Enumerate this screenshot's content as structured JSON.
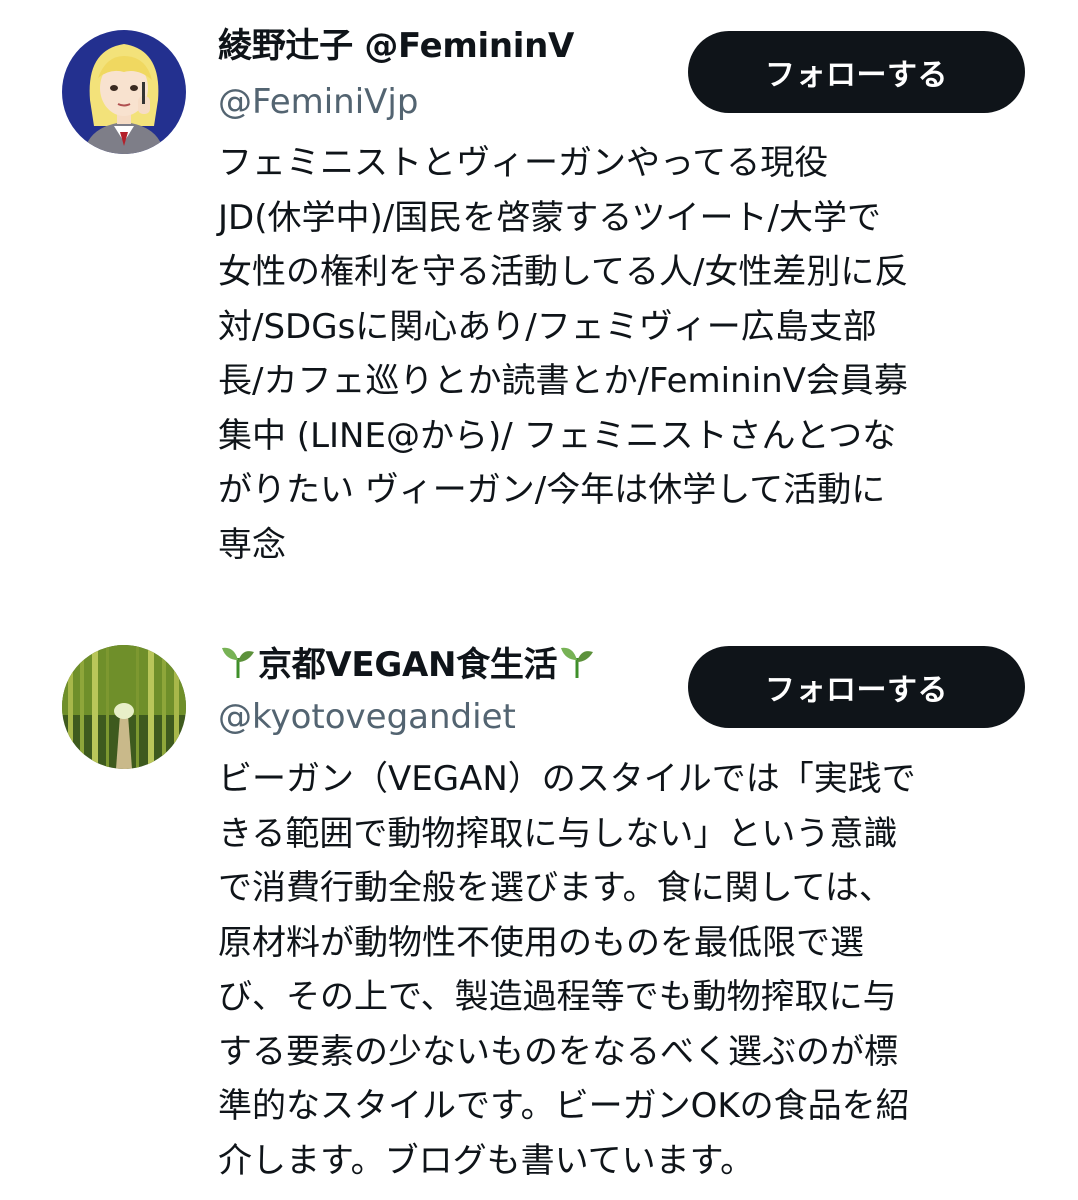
{
  "accounts": [
    {
      "name": "綾野辻子 @FemininV",
      "handle": "@FeminiVjp",
      "follow_label": "フォローする",
      "avatar_icon": "illustrated-woman-avatar",
      "bio_lines": [
        "フェミニストとヴィーガンやってる現役",
        "JD(休学中)/国民を啓蒙するツイート/大学で",
        "女性の権利を守る活動してる人/女性差別に反",
        "対/SDGsに関心あり/フェミヴィー広島支部",
        "長/カフェ巡りとか読書とか/FemininV会員募",
        "集中 (LINE@から)/ フェミニストさんとつな",
        "がりたい ヴィーガン/今年は休学して活動に",
        "専念"
      ]
    },
    {
      "name_prefix_icon": "seedling-icon",
      "name": "京都VEGAN食生活",
      "name_suffix_icon": "seedling-icon",
      "handle": "@kyotovegandiet",
      "follow_label": "フォローする",
      "avatar_icon": "bamboo-forest-avatar",
      "bio_lines": [
        "ビーガン（VEGAN）のスタイルでは「実践で",
        "きる範囲で動物搾取に与しない」という意識",
        "で消費行動全般を選びます。食に関しては、",
        "原材料が動物性不使用のものを最低限で選",
        "び、その上で、製造過程等でも動物搾取に与",
        "する要素の少ないものをなるべく選ぶのが標",
        "準的なスタイルです。ビーガンOKの食品を紹",
        "介します。ブログも書いています。"
      ]
    }
  ],
  "colors": {
    "text": "#0f1419",
    "secondary_text": "#536471",
    "button_bg": "#0f1419",
    "button_text": "#ffffff"
  }
}
